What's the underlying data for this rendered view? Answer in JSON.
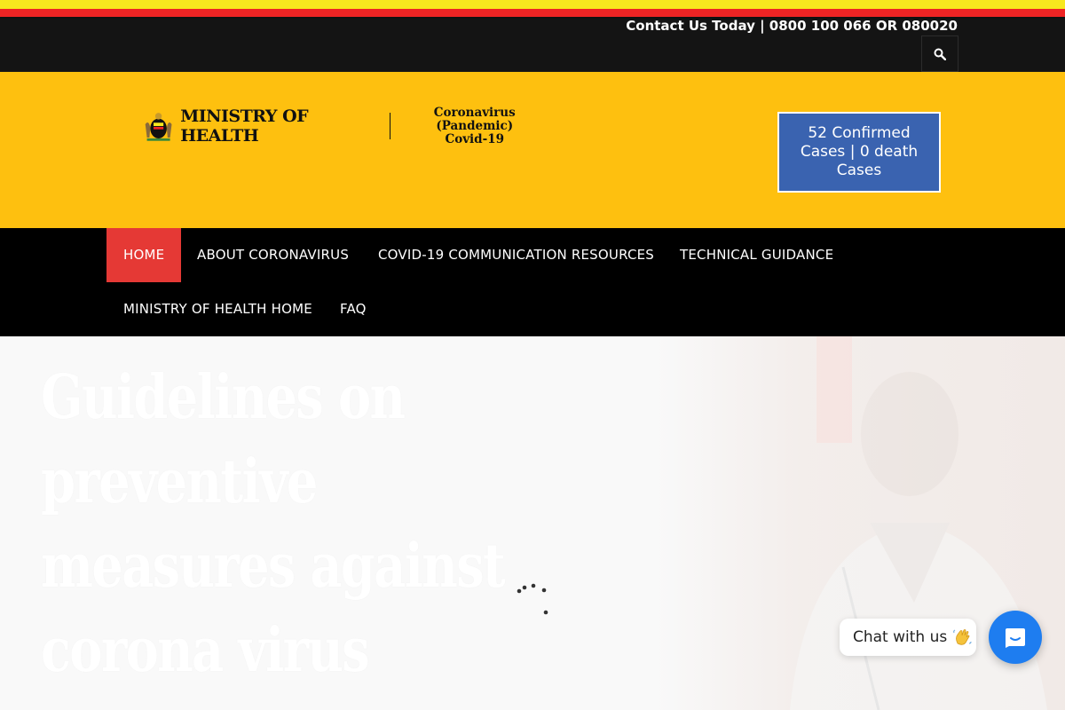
{
  "topbar": {
    "contact_text": "Contact Us Today | 0800 100 066 OR 080020",
    "search_icon": "search-icon"
  },
  "header": {
    "logo": {
      "ministry_text": "MINISTRY OF HEALTH",
      "campaign_line1": "Coronavirus (Pandemic)",
      "campaign_line2": "Covid-19",
      "emblem_icon": "coat-of-arms-icon"
    },
    "cases_box_text": "52 Confirmed Cases | 0 death Cases"
  },
  "nav": {
    "items": [
      {
        "label": "HOME",
        "active": true
      },
      {
        "label": "ABOUT CORONAVIRUS",
        "active": false
      },
      {
        "label": "COVID-19 COMMUNICATION RESOURCES",
        "active": false
      },
      {
        "label": "TECHNICAL GUIDANCE",
        "active": false
      },
      {
        "label": "MINISTRY OF HEALTH HOME",
        "active": false
      },
      {
        "label": "FAQ",
        "active": false
      }
    ]
  },
  "hero": {
    "title": "Guidelines on preventive measures against corona virus"
  },
  "chat": {
    "label": "Chat with us",
    "wave_icon": "waving-hand-icon",
    "button_icon": "chat-icon"
  },
  "colors": {
    "flag_yellow": "#f7e81e",
    "flag_red": "#ee2424",
    "header_yellow": "#fec00f",
    "cases_blue": "#3a63b0",
    "nav_active_red": "#e53935",
    "chat_blue": "#1e7df0"
  }
}
